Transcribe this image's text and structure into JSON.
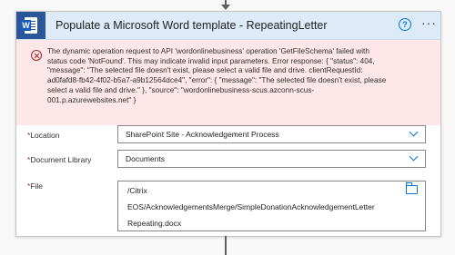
{
  "action": {
    "title": "Populate a Microsoft Word template - RepeatingLetter",
    "icon": "word-icon",
    "help_symbol": "?",
    "more_symbol": "···"
  },
  "error": {
    "lines": [
      "The dynamic operation request to API 'wordonlinebusiness' operation 'GetFileSchema' failed with",
      "status code 'NotFound'. This may indicate invalid input parameters. Error response: { \"status\": 404,",
      "\"message\": \"The selected file doesn't exist, please select a valid file and drive. clientRequestId:",
      "ad0fafd8-fb42-4f02-b5a7-a9b12564dce4\", \"error\": { \"message\": \"The selected file doesn't exist, please",
      "select a valid file and drive.\" }, \"source\": \"wordonlinebusiness-scus.azconn-scus-",
      "001.p.azurewebsites.net\" }"
    ]
  },
  "fields": {
    "location": {
      "label": "Location",
      "value": "SharePoint Site - Acknowledgement Process"
    },
    "document_library": {
      "label": "Document Library",
      "value": "Documents"
    },
    "file": {
      "label": "File",
      "lines": [
        "/Citrix",
        "EOS/AcknowledgementsMerge/SimpleDonationAcknowledgementLetter",
        "Repeating.docx"
      ]
    }
  },
  "required_mark": "*",
  "colors": {
    "accent": "#0078d4",
    "error_bg": "#fde7e9",
    "header_bg": "#ddeaf8",
    "word_blue": "#2b579a"
  }
}
